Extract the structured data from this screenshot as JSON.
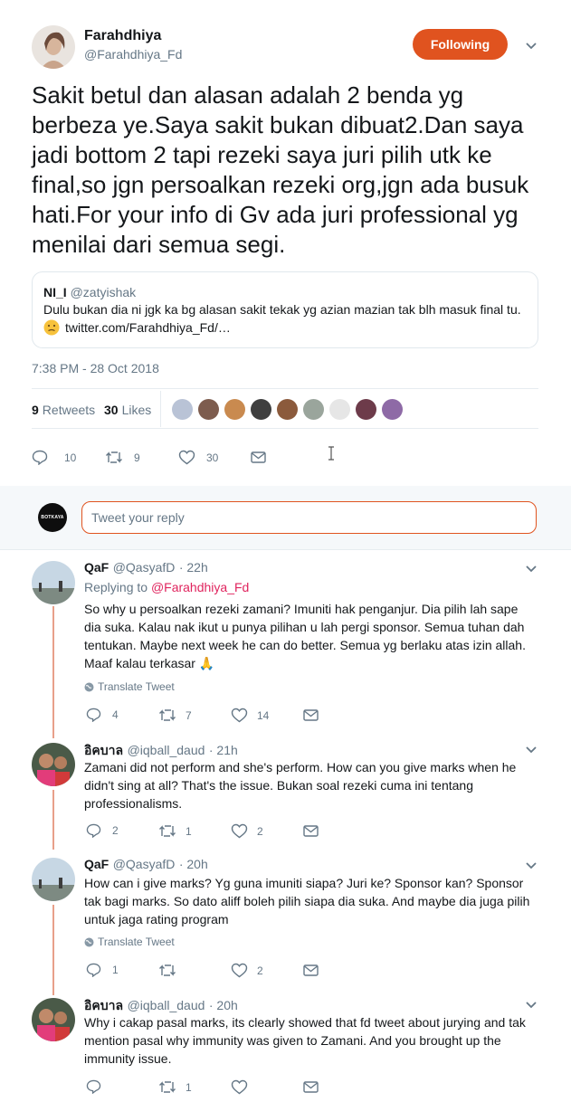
{
  "tweet": {
    "author_name": "Farahdhiya",
    "author_handle": "@Farahdhiya_Fd",
    "follow_label": "Following",
    "text": "Sakit betul dan alasan adalah 2 benda yg berbeza ye.Saya sakit bukan dibuat2.Dan saya jadi bottom 2 tapi rezeki saya juri pilih utk ke final,so jgn persoalkan rezeki org,jgn ada busuk hati.For your info di Gv ada juri professional yg menilai dari semua segi.",
    "quote": {
      "name": "NI_I",
      "handle": "@zatyishak",
      "text": "Dulu bukan dia ni jgk ka bg alasan sakit tekak yg azian mazian tak blh masuk final tu.",
      "link": "twitter.com/Farahdhiya_Fd/…"
    },
    "timestamp": "7:38 PM - 28 Oct 2018",
    "retweets_count": "9",
    "retweets_label": "Retweets",
    "likes_count": "30",
    "likes_label": "Likes",
    "actions": {
      "replies": "10",
      "retweets": "9",
      "likes": "30"
    }
  },
  "reply_composer": {
    "avatar_text": "BOTKAYA",
    "placeholder": "Tweet your reply"
  },
  "replies": [
    {
      "name": "QaF",
      "handle": "@QasyafD",
      "time": "· 22h",
      "replying_prefix": "Replying to",
      "replying_to": "@Farahdhiya_Fd",
      "text": "So why u persoalkan rezeki zamani? Imuniti hak penganjur. Dia pilih lah sape dia suka. Kalau nak ikut u punya pilihan u lah pergi sponsor. Semua tuhan dah tentukan. Maybe next week he can do better. Semua yg berlaku atas izin allah. Maaf kalau terkasar 🙏",
      "translate": "Translate Tweet",
      "replies": "4",
      "retweets": "7",
      "likes": "14"
    },
    {
      "name": "อิคบาล",
      "handle": "@iqball_daud",
      "time": "· 21h",
      "text": "Zamani did not perform and she's perform. How can you give marks when he didn't sing at all? That's the issue. Bukan soal rezeki cuma ini tentang professionalisms.",
      "replies": "2",
      "retweets": "1",
      "likes": "2"
    },
    {
      "name": "QaF",
      "handle": "@QasyafD",
      "time": "· 20h",
      "text": "How can i give marks? Yg guna imuniti siapa? Juri ke? Sponsor kan? Sponsor tak bagi marks. So dato aliff boleh pilih siapa dia suka. And maybe dia juga pilih untuk jaga rating program",
      "translate": "Translate Tweet",
      "replies": "1",
      "retweets": "",
      "likes": "2"
    },
    {
      "name": "อิคบาล",
      "handle": "@iqball_daud",
      "time": "· 20h",
      "text": "Why i cakap pasal marks, its clearly showed that fd tweet about jurying and tak mention pasal why immunity was given to Zamani. And you brought up the immunity issue.",
      "replies": "",
      "retweets": "1",
      "likes": ""
    }
  ],
  "colors": {
    "accent": "#e0531f",
    "link": "#e0245e",
    "muted": "#657786",
    "thread": "#e8a08a"
  }
}
